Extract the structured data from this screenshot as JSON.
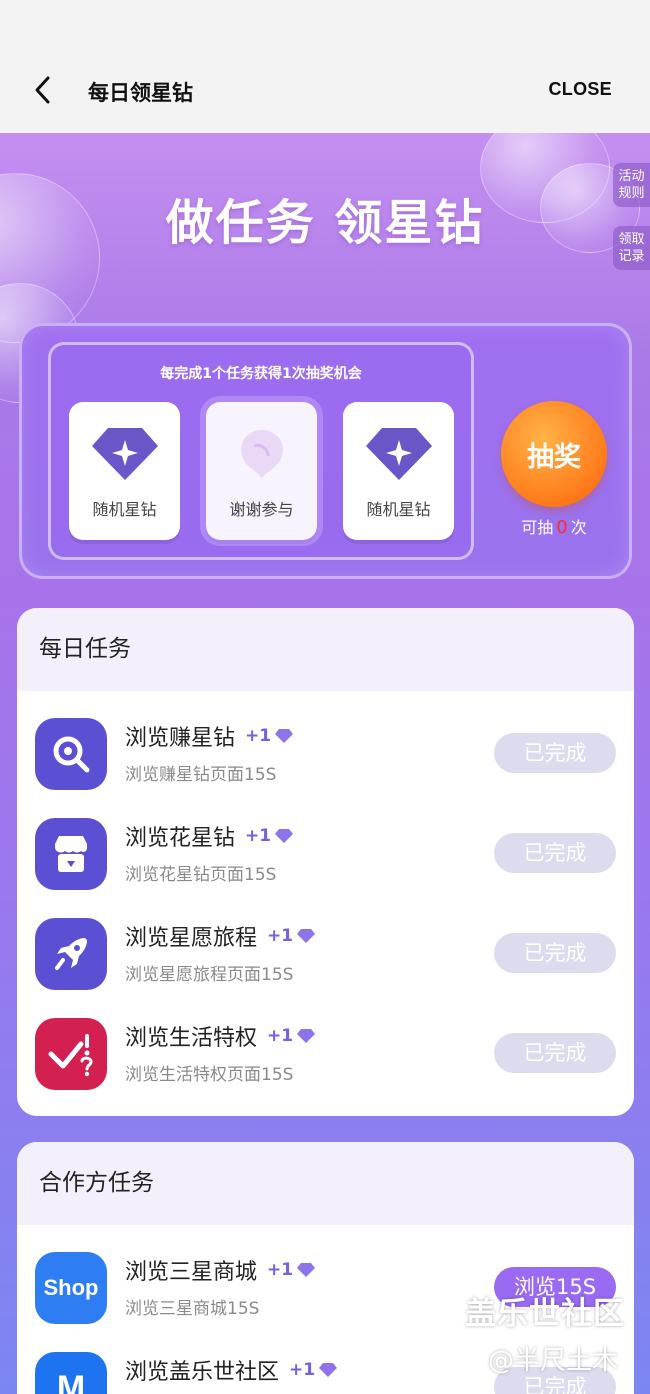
{
  "header": {
    "title": "每日领星钻",
    "close_label": "CLOSE"
  },
  "hero": {
    "title": "做任务 领星钻"
  },
  "side_tabs": [
    {
      "label": "活动规则"
    },
    {
      "label": "领取记录"
    }
  ],
  "lottery": {
    "hint": "每完成1个任务获得1次抽奖机会",
    "prizes": [
      {
        "label": "随机星钻"
      },
      {
        "label": "谢谢参与"
      },
      {
        "label": "随机星钻"
      }
    ],
    "draw_label": "抽奖",
    "chances_prefix": "可抽",
    "chances_count": "0",
    "chances_suffix": "次"
  },
  "daily": {
    "title": "每日任务",
    "tasks": [
      {
        "title": "浏览赚星钻",
        "reward": "+1",
        "sub": "浏览赚星钻页面15S",
        "button": "已完成",
        "icon": "magnifier-icon"
      },
      {
        "title": "浏览花星钻",
        "reward": "+1",
        "sub": "浏览花星钻页面15S",
        "button": "已完成",
        "icon": "store-icon"
      },
      {
        "title": "浏览星愿旅程",
        "reward": "+1",
        "sub": "浏览星愿旅程页面15S",
        "button": "已完成",
        "icon": "rocket-icon"
      },
      {
        "title": "浏览生活特权",
        "reward": "+1",
        "sub": "浏览生活特权页面15S",
        "button": "已完成",
        "icon": "check-question-icon"
      }
    ]
  },
  "partner": {
    "title": "合作方任务",
    "tasks": [
      {
        "title": "浏览三星商城",
        "reward": "+1",
        "sub": "浏览三星商城15S",
        "button": "浏览15S",
        "icon": "shop-icon",
        "icon_text": "Shop"
      },
      {
        "title": "浏览盖乐世社区",
        "reward": "+1",
        "button": "已完成",
        "icon": "members-icon",
        "icon_text": "M"
      }
    ]
  },
  "watermark": {
    "line1": "盖乐世社区",
    "line2": "@半尺土木"
  },
  "colors": {
    "accent": "#7a5ee0",
    "done_button": "#dcdcef",
    "active_button": "#9a6bf2",
    "draw_button": "#ff7a1a"
  }
}
